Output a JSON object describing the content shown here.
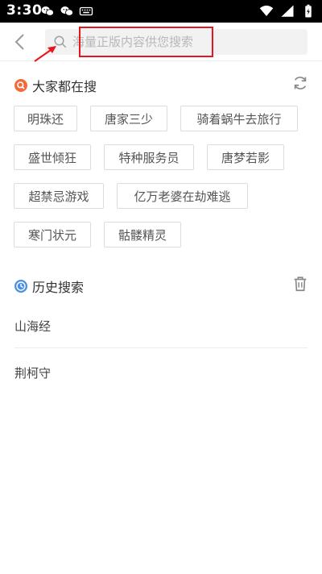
{
  "status_bar": {
    "time": "3:30",
    "left_icons": [
      "wechat-icon",
      "wechat-icon",
      "keyboard-icon"
    ],
    "right_icons": [
      "wifi-icon",
      "signal-icon",
      "battery-icon"
    ]
  },
  "search": {
    "placeholder": "海量正版内容供您搜索",
    "value": ""
  },
  "hot": {
    "title": "大家都在搜",
    "icon": "search-badge-icon",
    "refresh_icon": "refresh-icon",
    "tags": [
      "明珠还",
      "唐家三少",
      "骑着蜗牛去旅行",
      "盛世倾狂",
      "特种服务员",
      "唐梦若影",
      "超禁忌游戏",
      "亿万老婆在劫难逃",
      "寒门状元",
      "骷髅精灵"
    ]
  },
  "history": {
    "title": "历史搜索",
    "icon": "clock-icon",
    "clear_icon": "trash-icon",
    "items": [
      "山海经",
      "荆柯守"
    ]
  },
  "colors": {
    "accent_orange": "#f26b3a",
    "accent_blue": "#4a90e2",
    "annotation_red": "#e8141e"
  }
}
